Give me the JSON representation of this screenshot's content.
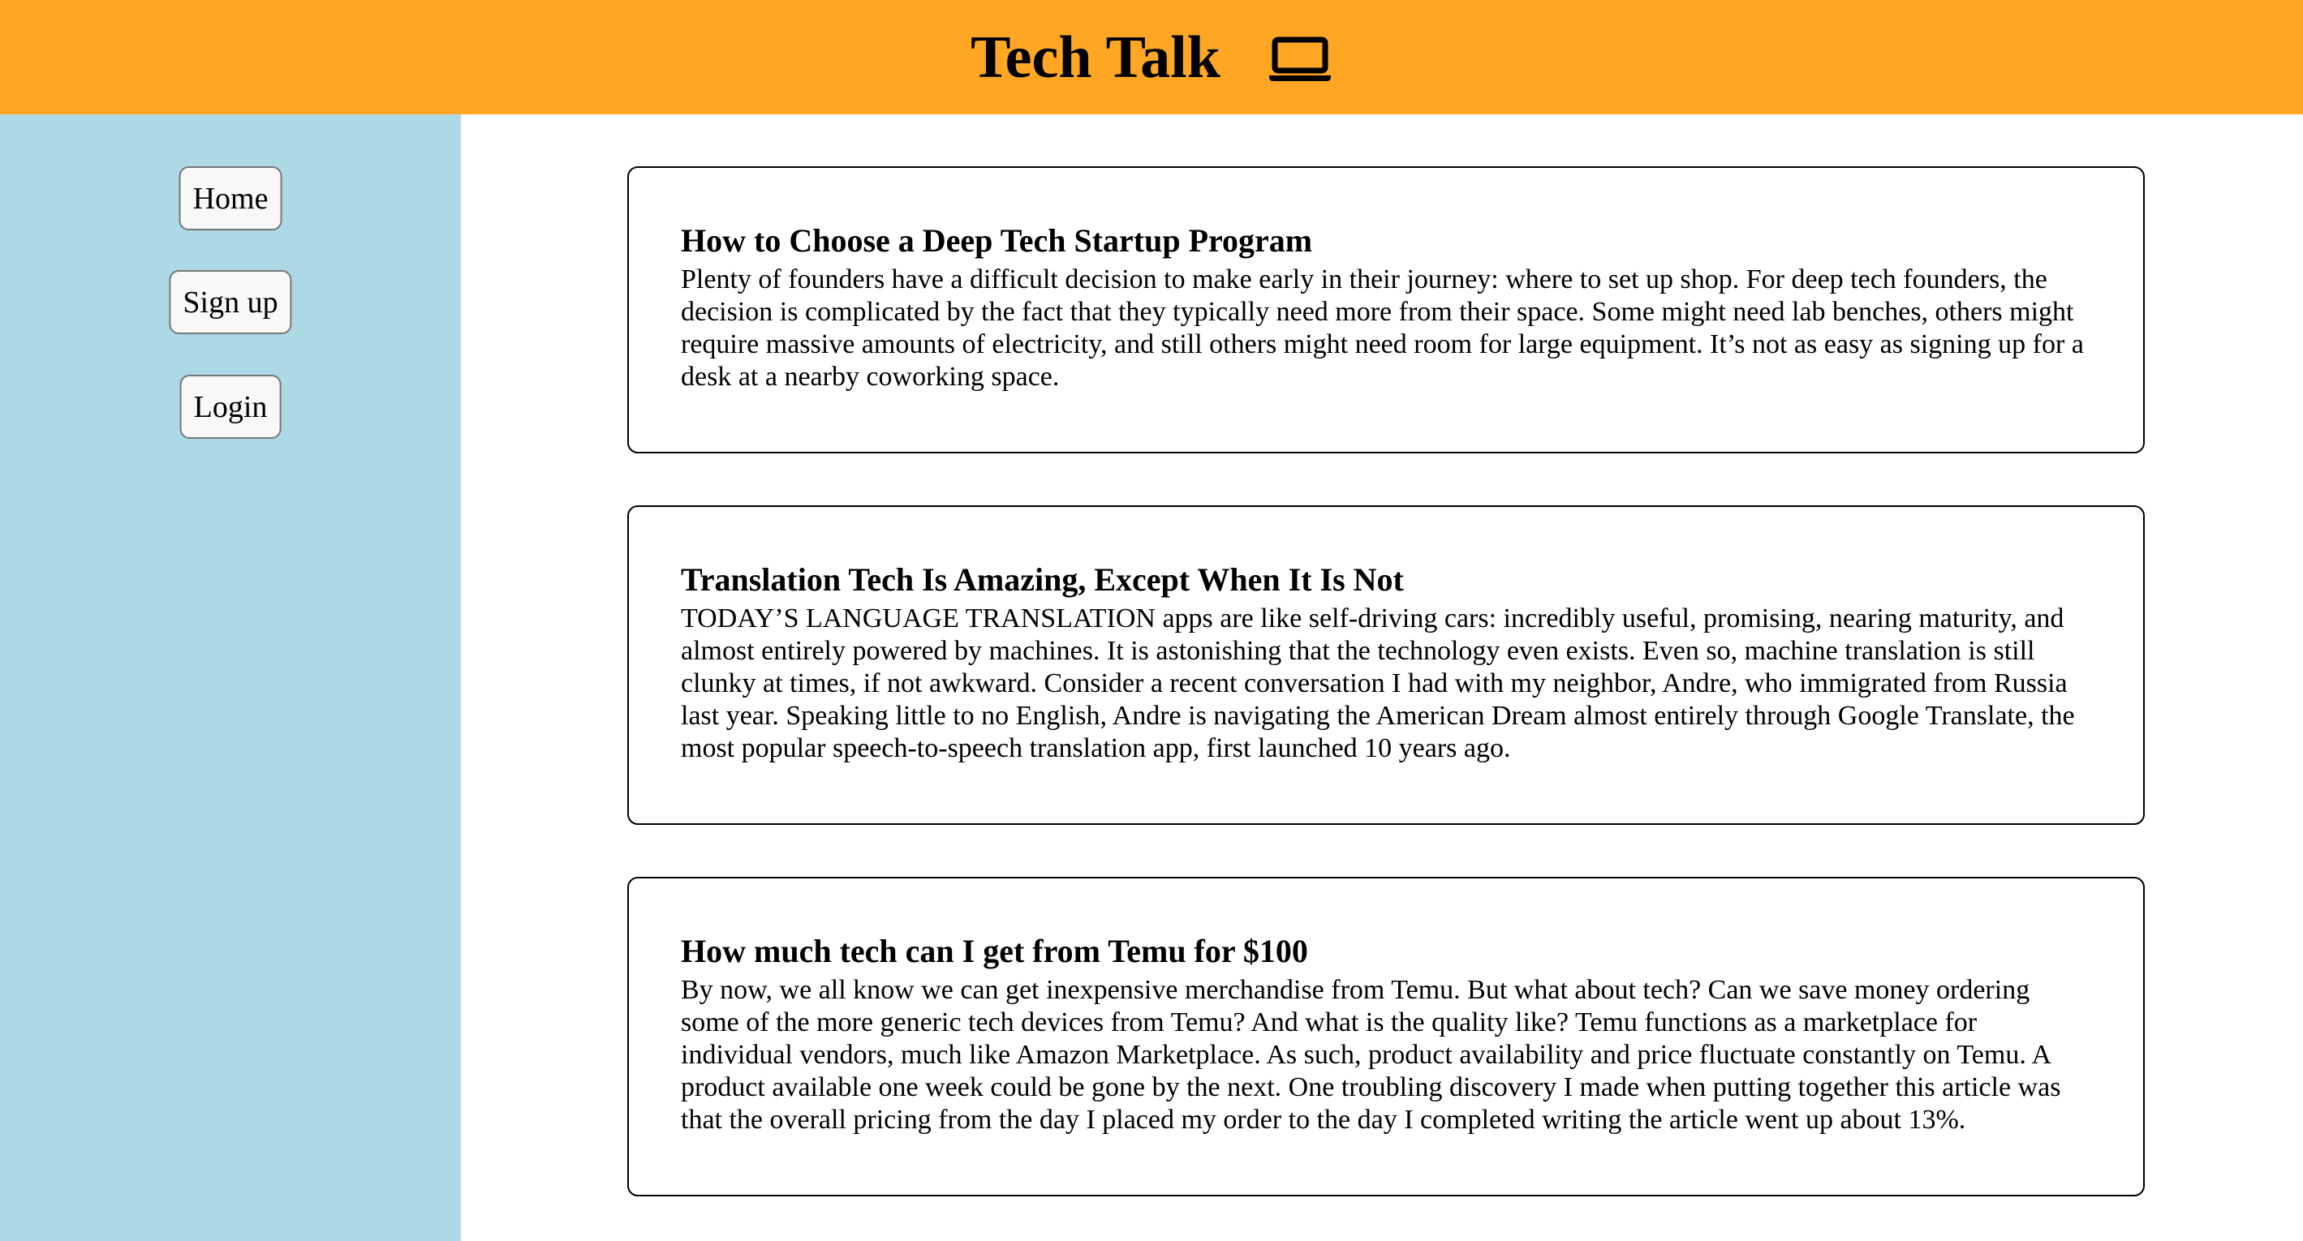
{
  "header": {
    "title": "Tech Talk",
    "icon": "laptop-icon",
    "background_color": "#FFA724"
  },
  "sidebar": {
    "background_color": "#ADD8E6",
    "items": [
      {
        "label": "Home"
      },
      {
        "label": "Sign up"
      },
      {
        "label": "Login"
      }
    ]
  },
  "articles": [
    {
      "title": "How to Choose a Deep Tech Startup Program",
      "body": "Plenty of founders have a difficult decision to make early in their journey: where to set up shop. For deep tech founders, the decision is complicated by the fact that they typically need more from their space. Some might need lab benches, others might require massive amounts of electricity, and still others might need room for large equipment. It’s not as easy as signing up for a desk at a nearby coworking space."
    },
    {
      "title": "Translation Tech Is Amazing, Except When It Is Not",
      "body": "TODAY’S LANGUAGE TRANSLATION apps are like self-driving cars: incredibly useful, promising, nearing maturity, and almost entirely powered by machines. It is astonishing that the technology even exists. Even so, machine translation is still clunky at times, if not awkward. Consider a recent conversation I had with my neighbor, Andre, who immigrated from Russia last year. Speaking little to no English, Andre is navigating the American Dream almost entirely through Google Translate, the most popular speech-to-speech translation app, first launched 10 years ago."
    },
    {
      "title": "How much tech can I get from Temu for $100",
      "body": "By now, we all know we can get inexpensive merchandise from Temu. But what about tech? Can we save money ordering some of the more generic tech devices from Temu? And what is the quality like? Temu functions as a marketplace for individual vendors, much like Amazon Marketplace. As such, product availability and price fluctuate constantly on Temu. A product available one week could be gone by the next. One troubling discovery I made when putting together this article was that the overall pricing from the day I placed my order to the day I completed writing the article went up about 13%."
    }
  ]
}
